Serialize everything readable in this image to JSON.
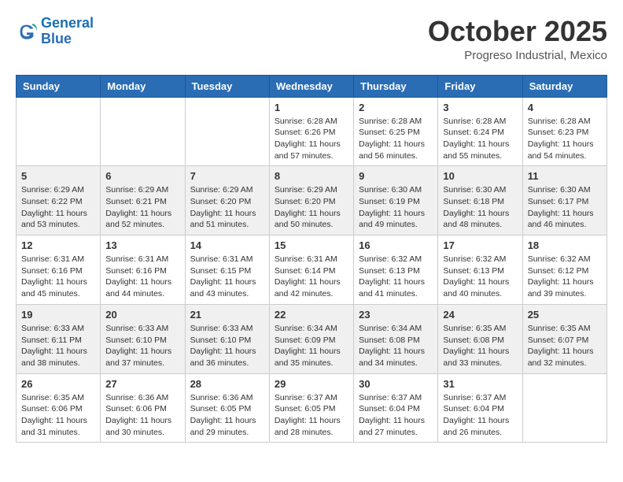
{
  "header": {
    "logo": {
      "line1": "General",
      "line2": "Blue"
    },
    "title": "October 2025",
    "subtitle": "Progreso Industrial, Mexico"
  },
  "weekdays": [
    "Sunday",
    "Monday",
    "Tuesday",
    "Wednesday",
    "Thursday",
    "Friday",
    "Saturday"
  ],
  "weeks": [
    [
      {
        "day": "",
        "empty": true
      },
      {
        "day": "",
        "empty": true
      },
      {
        "day": "",
        "empty": true
      },
      {
        "day": "1",
        "sunrise": "6:28 AM",
        "sunset": "6:26 PM",
        "daylight": "11 hours and 57 minutes."
      },
      {
        "day": "2",
        "sunrise": "6:28 AM",
        "sunset": "6:25 PM",
        "daylight": "11 hours and 56 minutes."
      },
      {
        "day": "3",
        "sunrise": "6:28 AM",
        "sunset": "6:24 PM",
        "daylight": "11 hours and 55 minutes."
      },
      {
        "day": "4",
        "sunrise": "6:28 AM",
        "sunset": "6:23 PM",
        "daylight": "11 hours and 54 minutes."
      }
    ],
    [
      {
        "day": "5",
        "sunrise": "6:29 AM",
        "sunset": "6:22 PM",
        "daylight": "11 hours and 53 minutes."
      },
      {
        "day": "6",
        "sunrise": "6:29 AM",
        "sunset": "6:21 PM",
        "daylight": "11 hours and 52 minutes."
      },
      {
        "day": "7",
        "sunrise": "6:29 AM",
        "sunset": "6:20 PM",
        "daylight": "11 hours and 51 minutes."
      },
      {
        "day": "8",
        "sunrise": "6:29 AM",
        "sunset": "6:20 PM",
        "daylight": "11 hours and 50 minutes."
      },
      {
        "day": "9",
        "sunrise": "6:30 AM",
        "sunset": "6:19 PM",
        "daylight": "11 hours and 49 minutes."
      },
      {
        "day": "10",
        "sunrise": "6:30 AM",
        "sunset": "6:18 PM",
        "daylight": "11 hours and 48 minutes."
      },
      {
        "day": "11",
        "sunrise": "6:30 AM",
        "sunset": "6:17 PM",
        "daylight": "11 hours and 46 minutes."
      }
    ],
    [
      {
        "day": "12",
        "sunrise": "6:31 AM",
        "sunset": "6:16 PM",
        "daylight": "11 hours and 45 minutes."
      },
      {
        "day": "13",
        "sunrise": "6:31 AM",
        "sunset": "6:16 PM",
        "daylight": "11 hours and 44 minutes."
      },
      {
        "day": "14",
        "sunrise": "6:31 AM",
        "sunset": "6:15 PM",
        "daylight": "11 hours and 43 minutes."
      },
      {
        "day": "15",
        "sunrise": "6:31 AM",
        "sunset": "6:14 PM",
        "daylight": "11 hours and 42 minutes."
      },
      {
        "day": "16",
        "sunrise": "6:32 AM",
        "sunset": "6:13 PM",
        "daylight": "11 hours and 41 minutes."
      },
      {
        "day": "17",
        "sunrise": "6:32 AM",
        "sunset": "6:13 PM",
        "daylight": "11 hours and 40 minutes."
      },
      {
        "day": "18",
        "sunrise": "6:32 AM",
        "sunset": "6:12 PM",
        "daylight": "11 hours and 39 minutes."
      }
    ],
    [
      {
        "day": "19",
        "sunrise": "6:33 AM",
        "sunset": "6:11 PM",
        "daylight": "11 hours and 38 minutes."
      },
      {
        "day": "20",
        "sunrise": "6:33 AM",
        "sunset": "6:10 PM",
        "daylight": "11 hours and 37 minutes."
      },
      {
        "day": "21",
        "sunrise": "6:33 AM",
        "sunset": "6:10 PM",
        "daylight": "11 hours and 36 minutes."
      },
      {
        "day": "22",
        "sunrise": "6:34 AM",
        "sunset": "6:09 PM",
        "daylight": "11 hours and 35 minutes."
      },
      {
        "day": "23",
        "sunrise": "6:34 AM",
        "sunset": "6:08 PM",
        "daylight": "11 hours and 34 minutes."
      },
      {
        "day": "24",
        "sunrise": "6:35 AM",
        "sunset": "6:08 PM",
        "daylight": "11 hours and 33 minutes."
      },
      {
        "day": "25",
        "sunrise": "6:35 AM",
        "sunset": "6:07 PM",
        "daylight": "11 hours and 32 minutes."
      }
    ],
    [
      {
        "day": "26",
        "sunrise": "6:35 AM",
        "sunset": "6:06 PM",
        "daylight": "11 hours and 31 minutes."
      },
      {
        "day": "27",
        "sunrise": "6:36 AM",
        "sunset": "6:06 PM",
        "daylight": "11 hours and 30 minutes."
      },
      {
        "day": "28",
        "sunrise": "6:36 AM",
        "sunset": "6:05 PM",
        "daylight": "11 hours and 29 minutes."
      },
      {
        "day": "29",
        "sunrise": "6:37 AM",
        "sunset": "6:05 PM",
        "daylight": "11 hours and 28 minutes."
      },
      {
        "day": "30",
        "sunrise": "6:37 AM",
        "sunset": "6:04 PM",
        "daylight": "11 hours and 27 minutes."
      },
      {
        "day": "31",
        "sunrise": "6:37 AM",
        "sunset": "6:04 PM",
        "daylight": "11 hours and 26 minutes."
      },
      {
        "day": "",
        "empty": true
      }
    ]
  ],
  "labels": {
    "sunrise": "Sunrise:",
    "sunset": "Sunset:",
    "daylight": "Daylight:"
  }
}
